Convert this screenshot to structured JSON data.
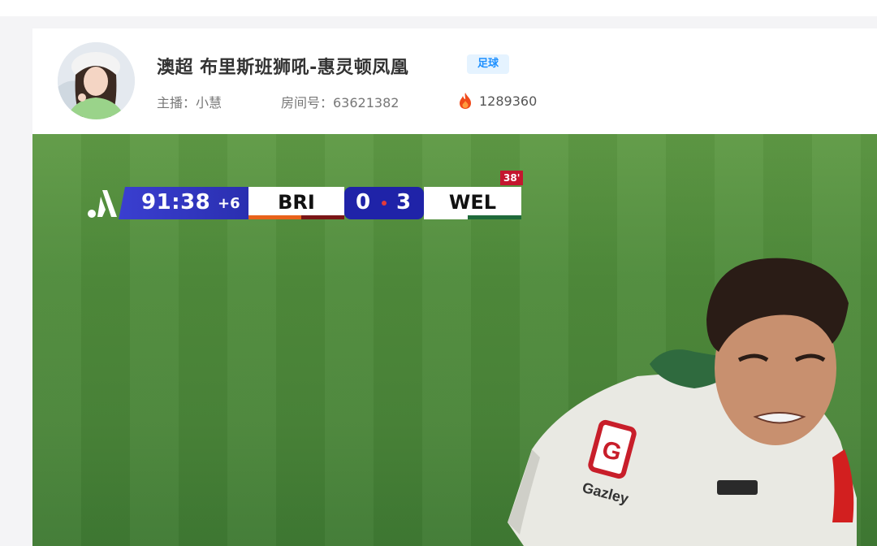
{
  "room": {
    "title": "澳超 布里斯班狮吼-惠灵顿凤凰",
    "category_tag": "足球",
    "host_label": "主播：小慧",
    "room_label": "房间号：63621382",
    "heat_icon": "flame-icon",
    "heat_value": "1289360",
    "colors": {
      "tag_text": "#1e90ff",
      "tag_bg": "#e5f3ff",
      "flame": "#f04a1a"
    }
  },
  "scoreboard": {
    "clock": "91:38",
    "added_time": "+6",
    "home_team": "BRI",
    "home_score": "0",
    "away_team": "WEL",
    "away_score": "3",
    "red_card_minute": "38'",
    "colors": {
      "clock_bg": "#3a3fd0",
      "score_bg": "#1f23a8",
      "red_card": "#c4162e"
    }
  },
  "player_jersey": {
    "badge_letter": "G",
    "sponsor": "Gazley"
  }
}
